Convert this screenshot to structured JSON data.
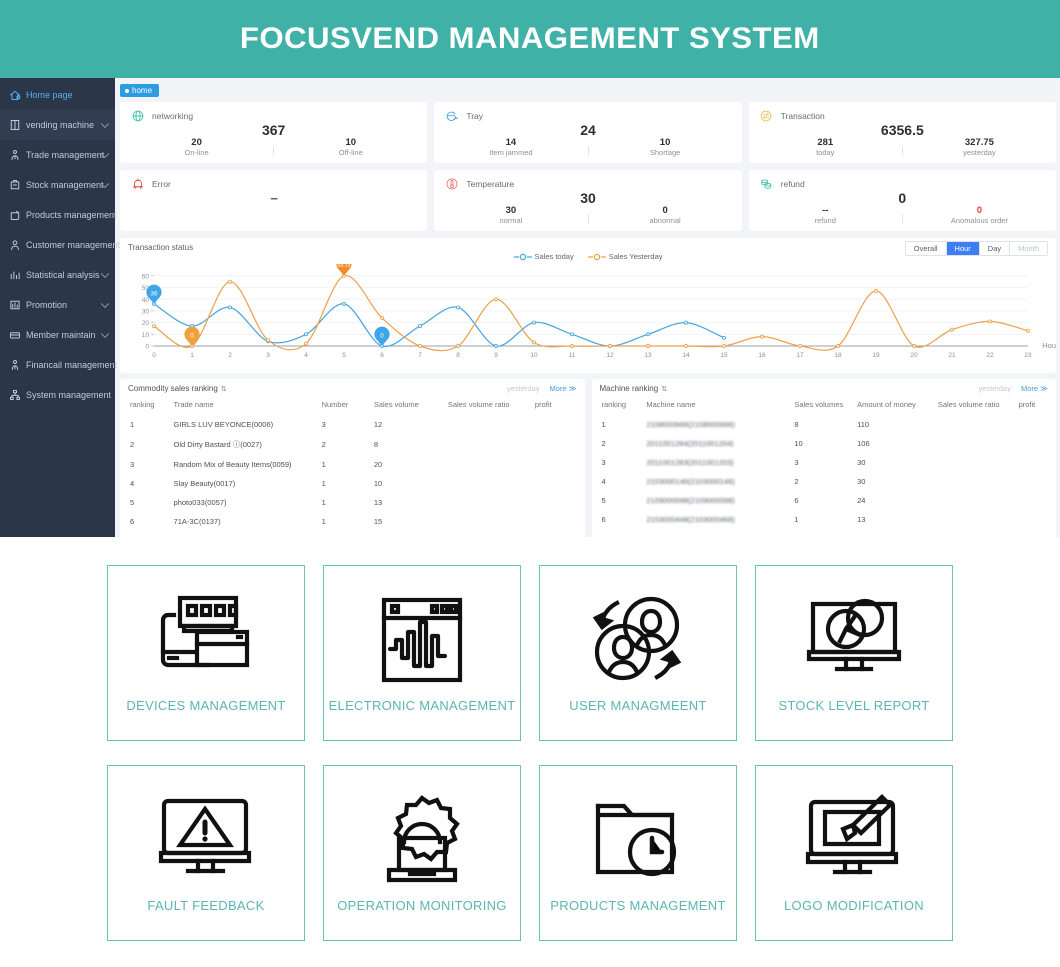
{
  "header": {
    "title": "FOCUSVEND MANAGEMENT SYSTEM",
    "bg": "#3fb1a6"
  },
  "sidebar": {
    "items": [
      {
        "label": "Home page",
        "icon": "home-icon",
        "active": true,
        "caret": false
      },
      {
        "label": "vending machine",
        "icon": "machine-icon",
        "active": false,
        "caret": true
      },
      {
        "label": "Trade management",
        "icon": "trade-icon",
        "active": false,
        "caret": true
      },
      {
        "label": "Stock management",
        "icon": "stock-icon",
        "active": false,
        "caret": true
      },
      {
        "label": "Products management",
        "icon": "products-icon",
        "active": false,
        "caret": false
      },
      {
        "label": "Customer management",
        "icon": "customer-icon",
        "active": false,
        "caret": false
      },
      {
        "label": "Statistical analysis",
        "icon": "statistics-icon",
        "active": false,
        "caret": true
      },
      {
        "label": "Promotion",
        "icon": "promotion-icon",
        "active": false,
        "caret": true
      },
      {
        "label": "Member maintain",
        "icon": "member-icon",
        "active": false,
        "caret": true
      },
      {
        "label": "Financail management",
        "icon": "finance-icon",
        "active": false,
        "caret": false
      },
      {
        "label": "System management",
        "icon": "system-icon",
        "active": false,
        "caret": false
      }
    ]
  },
  "tabs": {
    "home_label": "home"
  },
  "stats": [
    {
      "label": "networking",
      "icon": "globe-icon",
      "icon_color": "#47c3ab",
      "main": "367",
      "left": {
        "value": "20",
        "key": "On-line"
      },
      "right": {
        "value": "10",
        "key": "Off-line"
      }
    },
    {
      "label": "Tray",
      "icon": "tray-icon",
      "icon_color": "#4aa8e0",
      "main": "24",
      "left": {
        "value": "14",
        "key": "Item jammed"
      },
      "right": {
        "value": "10",
        "key": "Shortage"
      }
    },
    {
      "label": "Transaction",
      "icon": "exchange-icon",
      "icon_color": "#e8c04a",
      "main": "6356.5",
      "left": {
        "value": "281",
        "key": "today"
      },
      "right": {
        "value": "327.75",
        "key": "yesterday"
      }
    },
    {
      "label": "Error",
      "icon": "alarm-icon",
      "icon_color": "#e8413c",
      "main": "--",
      "left": {
        "value": "",
        "key": ""
      },
      "right": {
        "value": "",
        "key": ""
      }
    },
    {
      "label": "Temperature",
      "icon": "thermometer-icon",
      "icon_color": "#e87f73",
      "main": "30",
      "left": {
        "value": "30",
        "key": "normal"
      },
      "right": {
        "value": "0",
        "key": "abnormal"
      }
    },
    {
      "label": "refund",
      "icon": "coins-icon",
      "icon_color": "#47c3ab",
      "main": "0",
      "left": {
        "value": "--",
        "key": "refund"
      },
      "right": {
        "value": "0",
        "key": "Anomalous order",
        "value_color": "#e8413c"
      }
    }
  ],
  "chart_panel": {
    "title": "Transaction status",
    "segments": [
      {
        "label": "Overall",
        "active": false,
        "disabled": false
      },
      {
        "label": "Hour",
        "active": true,
        "disabled": false
      },
      {
        "label": "Day",
        "active": false,
        "disabled": false
      },
      {
        "label": "Month",
        "active": false,
        "disabled": true
      }
    ]
  },
  "chart_data": {
    "type": "line",
    "title": "Transaction status",
    "xlabel": "Hou",
    "ylabel": "",
    "xlim": [
      0,
      23
    ],
    "ylim": [
      0,
      65
    ],
    "yticks": [
      0,
      10,
      20,
      30,
      40,
      50,
      60
    ],
    "ytick_labels": [
      "0",
      "10",
      "20",
      "30",
      "40",
      "50",
      "60"
    ],
    "x": [
      0,
      1,
      2,
      3,
      4,
      5,
      6,
      7,
      8,
      9,
      10,
      11,
      12,
      13,
      14,
      15,
      16,
      17,
      18,
      19,
      20,
      21,
      22,
      23
    ],
    "xtick_labels": [
      "0",
      "1",
      "2",
      "3",
      "4",
      "5",
      "6",
      "7",
      "8",
      "9",
      "10",
      "11",
      "12",
      "13",
      "14",
      "15",
      "16",
      "17",
      "18",
      "19",
      "20",
      "21",
      "22",
      "23"
    ],
    "grid": true,
    "legend_position": "top-center",
    "series": [
      {
        "name": "Sales today",
        "color": "#4ba7e0",
        "values": [
          36,
          17,
          33,
          4,
          10,
          36,
          0,
          17,
          33,
          0,
          20,
          10,
          0,
          10,
          20,
          7,
          null,
          null,
          null,
          null,
          null,
          null,
          null,
          null
        ]
      },
      {
        "name": "Sales Yesterday",
        "color": "#eda24c",
        "values": [
          17,
          0,
          55,
          5,
          2,
          60,
          24,
          0,
          0,
          40,
          3,
          0,
          0,
          0,
          0,
          0,
          8,
          0,
          0,
          47,
          0,
          14,
          21,
          13
        ]
      }
    ],
    "annotations": [
      {
        "text": "36",
        "x": 0,
        "y": 36,
        "color": "#3ea6e8",
        "shape": "pin"
      },
      {
        "text": "0",
        "x": 1,
        "y": 0,
        "color": "#f0a03c",
        "shape": "pin"
      },
      {
        "text": "69.75",
        "x": 5,
        "y": 60,
        "color": "#ef8e2a",
        "shape": "pin"
      },
      {
        "text": "0",
        "x": 6,
        "y": 0,
        "color": "#3ea6e8",
        "shape": "pin"
      }
    ]
  },
  "commodity_table": {
    "title": "Commodity sales ranking",
    "sort_icon": "sort-icon",
    "yesterday_label": "yesterday",
    "more_label": "More ≫",
    "columns": [
      "ranking",
      "Trade name",
      "Number",
      "Sales volume",
      "Sales volume ratio",
      "profit"
    ],
    "rows": [
      [
        "1",
        "GIRLS LUV BEYONCE(0006)",
        "3",
        "12",
        "",
        ""
      ],
      [
        "2",
        "Old Dirty Bastard ⓘ(0027)",
        "2",
        "8",
        "",
        ""
      ],
      [
        "3",
        "Random Mix of Beauty Items(0059)",
        "1",
        "20",
        "",
        ""
      ],
      [
        "4",
        "Slay Beauty(0017)",
        "1",
        "10",
        "",
        ""
      ],
      [
        "5",
        "photo033(0057)",
        "1",
        "13",
        "",
        ""
      ],
      [
        "6",
        "71A-3C(0137)",
        "1",
        "15",
        "",
        ""
      ]
    ]
  },
  "machine_table": {
    "title": "Machine ranking",
    "sort_icon": "sort-icon",
    "yesterday_label": "yesterday",
    "more_label": "More ≫",
    "columns": [
      "ranking",
      "Machine name",
      "Sales volumes",
      "Amount of money",
      "Sales volume ratio",
      "profit"
    ],
    "rows": [
      [
        "1",
        "2108000666(2108000666)",
        "8",
        "110",
        "",
        ""
      ],
      [
        "2",
        "2011001284(2011001204)",
        "10",
        "106",
        "",
        ""
      ],
      [
        "3",
        "2011001283(2011001203)",
        "3",
        "30",
        "",
        ""
      ],
      [
        "4",
        "2103000146(2103000146)",
        "2",
        "30",
        "",
        ""
      ],
      [
        "5",
        "2109000098(2109000098)",
        "6",
        "24",
        "",
        ""
      ],
      [
        "6",
        "2103000448(2103000468)",
        "1",
        "13",
        "",
        ""
      ]
    ]
  },
  "shortcuts": {
    "border_color": "#66c0bb",
    "label_color": "#5bb5b2",
    "rows": [
      [
        {
          "label": "DEVICES MANAGEMENT",
          "icon": "devices-icon"
        },
        {
          "label": "ELECTRONIC MANAGEMENT",
          "icon": "waveform-window-icon"
        },
        {
          "label": "USER MANAGMEENT",
          "icon": "users-cycle-icon"
        },
        {
          "label": "STOCK LEVEL REPORT",
          "icon": "monitor-pie-icon"
        }
      ],
      [
        {
          "label": "FAULT FEEDBACK",
          "icon": "monitor-warning-icon"
        },
        {
          "label": "OPERATION MONITORING",
          "icon": "gear-laptop-icon"
        },
        {
          "label": "PRODUCTS MANAGEMENT",
          "icon": "folder-clock-icon"
        },
        {
          "label": "LOGO MODIFICATION",
          "icon": "monitor-brush-icon"
        }
      ]
    ]
  }
}
